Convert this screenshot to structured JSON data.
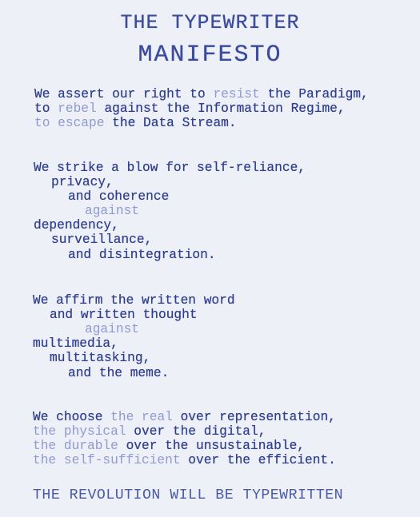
{
  "title": {
    "line1": "THE TYPEWRITER",
    "line2": "MANIFESTO"
  },
  "stanza1": {
    "l1_a": "We assert our right to ",
    "l1_b": "resist",
    "l1_c": " the Paradigm,",
    "l2_a": "to ",
    "l2_b": "rebel",
    "l2_c": " against the Information Regime,",
    "l3_a": "to ",
    "l3_b": "escape",
    "l3_c": " the Data Stream."
  },
  "stanza2": {
    "l1": "We strike a blow for self-reliance,",
    "l2": "privacy,",
    "l3": "and coherence",
    "l4": "against",
    "l5": "dependency,",
    "l6": "surveillance,",
    "l7": "and disintegration."
  },
  "stanza3": {
    "l1": "We affirm the written word",
    "l2": "and written thought",
    "l3": "against",
    "l4": "multimedia,",
    "l5": "multitasking,",
    "l6": "and the meme."
  },
  "stanza4": {
    "l1_a": "We choose ",
    "l1_b": "the real",
    "l1_c": " over representation,",
    "l2_a": "the physical",
    "l2_b": " over the digital,",
    "l3_a": "the durable",
    "l3_b": " over the unsustainable,",
    "l4_a": "the self-sufficient",
    "l4_b": " over the efficient."
  },
  "footer": "THE REVOLUTION WILL BE TYPEWRITTEN"
}
